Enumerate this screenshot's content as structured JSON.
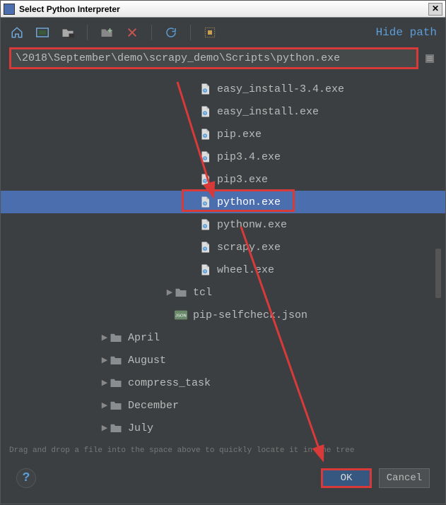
{
  "window": {
    "title": "Select Python Interpreter"
  },
  "toolbar": {
    "hide_path_label": "Hide path"
  },
  "path": {
    "value": "\\2018\\September\\demo\\scrapy_demo\\Scripts\\python.exe"
  },
  "tree": {
    "items": [
      {
        "type": "file",
        "indent": 260,
        "name": "easy_install-3.4.exe",
        "selected": false
      },
      {
        "type": "file",
        "indent": 260,
        "name": "easy_install.exe",
        "selected": false
      },
      {
        "type": "file",
        "indent": 260,
        "name": "pip.exe",
        "selected": false
      },
      {
        "type": "file",
        "indent": 260,
        "name": "pip3.4.exe",
        "selected": false
      },
      {
        "type": "file",
        "indent": 260,
        "name": "pip3.exe",
        "selected": false
      },
      {
        "type": "file",
        "indent": 260,
        "name": "python.exe",
        "selected": true,
        "highlighted": true
      },
      {
        "type": "file",
        "indent": 260,
        "name": "pythonw.exe",
        "selected": false
      },
      {
        "type": "file",
        "indent": 260,
        "name": "scrapy.exe",
        "selected": false
      },
      {
        "type": "file",
        "indent": 260,
        "name": "wheel.exe",
        "selected": false
      },
      {
        "type": "folder",
        "indent": 226,
        "name": "tcl",
        "expand": "▶"
      },
      {
        "type": "json",
        "indent": 226,
        "name": "pip-selfcheck.json"
      },
      {
        "type": "folder",
        "indent": 134,
        "name": "April",
        "expand": "▶"
      },
      {
        "type": "folder",
        "indent": 134,
        "name": "August",
        "expand": "▶"
      },
      {
        "type": "folder",
        "indent": 134,
        "name": "compress_task",
        "expand": "▶"
      },
      {
        "type": "folder",
        "indent": 134,
        "name": "December",
        "expand": "▶"
      },
      {
        "type": "folder",
        "indent": 134,
        "name": "July",
        "expand": "▶"
      }
    ]
  },
  "hint": "Drag and drop a file into the space above to quickly locate it in the tree",
  "buttons": {
    "ok": "OK",
    "cancel": "Cancel"
  },
  "colors": {
    "highlight": "#d83a3a",
    "selection": "#4b6eaf",
    "link": "#5b9dd9"
  }
}
